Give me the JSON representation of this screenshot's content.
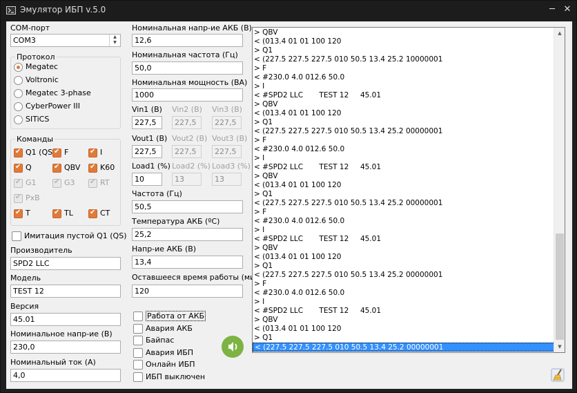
{
  "window": {
    "title": "Эмулятор ИБП v.5.0",
    "minimize": "─",
    "close": "✕"
  },
  "com": {
    "label": "COM-порт",
    "value": "COM3"
  },
  "protocol": {
    "title": "Протокол",
    "options": [
      "Megatec",
      "Voltronic",
      "Megatec 3-phase",
      "CyberPower III",
      "SITiCS"
    ],
    "selected": 0
  },
  "commands": {
    "title": "Команды",
    "items": [
      {
        "label": "Q1 (QS)",
        "checked": true,
        "enabled": true
      },
      {
        "label": "F",
        "checked": true,
        "enabled": true
      },
      {
        "label": "I",
        "checked": true,
        "enabled": true
      },
      {
        "label": "Q",
        "checked": true,
        "enabled": true
      },
      {
        "label": "QBV",
        "checked": true,
        "enabled": true
      },
      {
        "label": "K60",
        "checked": true,
        "enabled": true
      },
      {
        "label": "G1",
        "checked": true,
        "enabled": false
      },
      {
        "label": "G3",
        "checked": true,
        "enabled": false
      },
      {
        "label": "RT",
        "checked": true,
        "enabled": false
      },
      {
        "label": "PxB",
        "checked": true,
        "enabled": false
      },
      {
        "label": "T",
        "checked": true,
        "enabled": true
      },
      {
        "label": "TL",
        "checked": true,
        "enabled": true
      },
      {
        "label": "CT",
        "checked": true,
        "enabled": true
      }
    ]
  },
  "empty_q1": {
    "label": "Имитация пустой Q1 (QS)",
    "checked": false
  },
  "manufacturer": {
    "label": "Производитель",
    "value": "SPD2 LLC"
  },
  "model": {
    "label": "Модель",
    "value": "TEST 12"
  },
  "version": {
    "label": "Версия",
    "value": "45.01"
  },
  "nominal_voltage": {
    "label": "Номинальное напр-ие (В)",
    "value": "230,0"
  },
  "nominal_current": {
    "label": "Номинальный ток (А)",
    "value": "4,0"
  },
  "battery_nominal_voltage": {
    "label": "Номинальная напр-ие АКБ (В)",
    "value": "12,6"
  },
  "nominal_frequency": {
    "label": "Номинальная частота (Гц)",
    "value": "50,0"
  },
  "nominal_power": {
    "label": "Номинальная мощность (ВА)",
    "value": "1000"
  },
  "vin": {
    "labels": [
      "Vin1 (В)",
      "Vin2 (В)",
      "Vin3 (В)"
    ],
    "values": [
      "227,5",
      "227,5",
      "227,5"
    ]
  },
  "vout": {
    "labels": [
      "Vout1 (В)",
      "Vout2 (В)",
      "Vout3 (В)"
    ],
    "values": [
      "227,5",
      "227,5",
      "227,5"
    ]
  },
  "load": {
    "labels": [
      "Load1 (%)",
      "Load2 (%)",
      "Load3 (%)"
    ],
    "values": [
      "10",
      "13",
      "13"
    ]
  },
  "frequency": {
    "label": "Частота (Гц)",
    "value": "50,5"
  },
  "battery_temp": {
    "label": "Температура АКБ (ºС)",
    "value": "25,2"
  },
  "battery_voltage": {
    "label": "Напр-ие АКБ (В)",
    "value": "13,4"
  },
  "remaining_time": {
    "label": "Оставшееся время работы (мин)",
    "value": "120"
  },
  "status_flags": [
    {
      "label": "Работа от АКБ",
      "checked": false
    },
    {
      "label": "Авария АКБ",
      "checked": false
    },
    {
      "label": "Байпас",
      "checked": false
    },
    {
      "label": "Авария ИБП",
      "checked": false
    },
    {
      "label": "Онлайн ИБП",
      "checked": false
    },
    {
      "label": "ИБП выключен",
      "checked": false
    }
  ],
  "log": {
    "lines": [
      "> QBV",
      "< (013.4 01 01 100 120",
      "> Q1",
      "< (227.5 227.5 227.5 010 50.5 13.4 25.2 10000001",
      "> F",
      "< #230.0 4.0 012.6 50.0",
      "> I",
      "< #SPD2 LLC       TEST 12     45.01",
      "> QBV",
      "< (013.4 01 01 100 120",
      "> Q1",
      "< (227.5 227.5 227.5 010 50.5 13.4 25.2 00000001",
      "> F",
      "< #230.0 4.0 012.6 50.0",
      "> I",
      "< #SPD2 LLC       TEST 12     45.01",
      "> QBV",
      "< (013.4 01 01 100 120",
      "> Q1",
      "< (227.5 227.5 227.5 010 50.5 13.4 25.2 00000001",
      "> F",
      "< #230.0 4.0 012.6 50.0",
      "> I",
      "< #SPD2 LLC       TEST 12     45.01",
      "> QBV",
      "< (013.4 01 01 100 120",
      "> Q1",
      "< (227.5 227.5 227.5 010 50.5 13.4 25.2 00000001",
      "> F",
      "< #230.0 4.0 012.6 50.0",
      "> I",
      "< #SPD2 LLC       TEST 12     45.01",
      "> QBV",
      "< (013.4 01 01 100 120",
      "> Q1",
      "< (227.5 227.5 227.5 010 50.5 13.4 25.2 00000001"
    ],
    "selected_index": 35
  },
  "colors": {
    "accent": "#e07a3b",
    "selection": "#3390ff",
    "sound_button": "#7cb342"
  },
  "icons": {
    "sound": "speaker-icon",
    "clear": "broom-icon"
  }
}
